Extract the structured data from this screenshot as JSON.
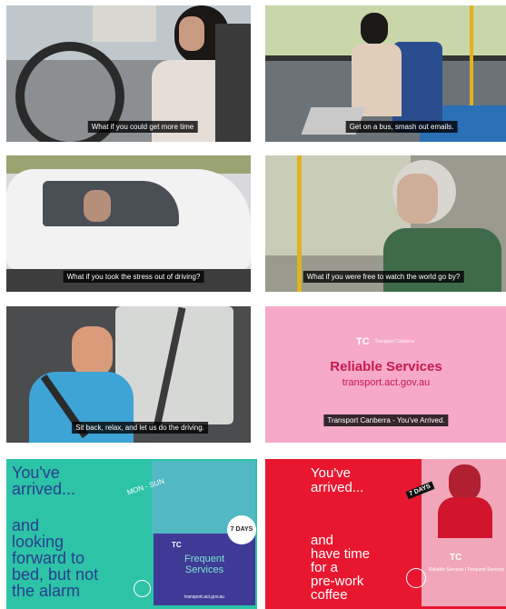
{
  "tiles": [
    {
      "subtitle": "What if you could get more time"
    },
    {
      "subtitle": "Get on a bus, smash out emails."
    },
    {
      "subtitle": "What if you took the stress out of driving?"
    },
    {
      "subtitle": "What if you were free to watch the world go by?"
    },
    {
      "subtitle": "Sit back, relax, and let us do the driving."
    },
    {
      "logo": "TC",
      "logo_small": "Transport Canberra",
      "title": "Reliable Services",
      "url": "transport.act.gov.au",
      "subtitle": "Transport Canberra - You've Arrived."
    },
    {
      "heading_line1": "You've",
      "heading_line2": "arrived...",
      "body_lines": [
        "and",
        "looking",
        "forward to",
        "bed, but not",
        "the alarm"
      ],
      "mon_sun": "MON - SUN",
      "badge": "7 DAYS",
      "panel_logo": "TC",
      "panel_title_line1": "Frequent",
      "panel_title_line2": "Services",
      "panel_url": "transport.act.gov.au"
    },
    {
      "heading_line1": "You've",
      "heading_line2": "arrived...",
      "body_lines": [
        "and",
        "have time",
        "for a",
        "pre-work",
        "coffee"
      ],
      "badge": "7 DAYS",
      "logo": "TC",
      "services": "Reliable Services | Frequent Services"
    }
  ]
}
